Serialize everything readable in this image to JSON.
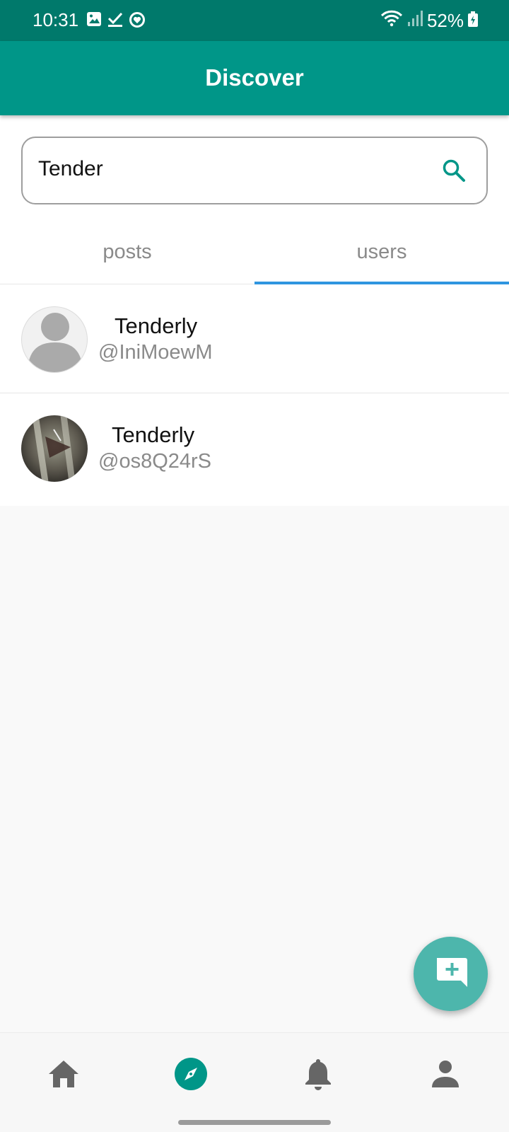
{
  "status_bar": {
    "time": "10:31",
    "battery": "52%",
    "icons": [
      "image-icon",
      "check-icon",
      "heart-shield-icon",
      "wifi-icon",
      "signal-icon",
      "battery-charging-icon"
    ]
  },
  "app_bar": {
    "title": "Discover"
  },
  "search": {
    "value": "Tender",
    "icon": "search-icon"
  },
  "tabs": [
    {
      "label": "posts",
      "selected": false
    },
    {
      "label": "users",
      "selected": true
    }
  ],
  "users": [
    {
      "name": "Tenderly",
      "handle": "@IniMoewM",
      "avatar": "default-avatar"
    },
    {
      "name": "Tenderly",
      "handle": "@os8Q24rS",
      "avatar": "photo-avatar"
    }
  ],
  "fab": {
    "icon": "add-comment-icon"
  },
  "bottom_nav": [
    {
      "icon": "home-icon",
      "active": false
    },
    {
      "icon": "compass-icon",
      "active": true
    },
    {
      "icon": "bell-icon",
      "active": false
    },
    {
      "icon": "person-icon",
      "active": false
    }
  ],
  "colors": {
    "status_bar": "#00796b",
    "primary": "#009688",
    "fab": "#4db6ac",
    "tab_indicator": "#2f95e0",
    "icon_gray": "#666666"
  }
}
